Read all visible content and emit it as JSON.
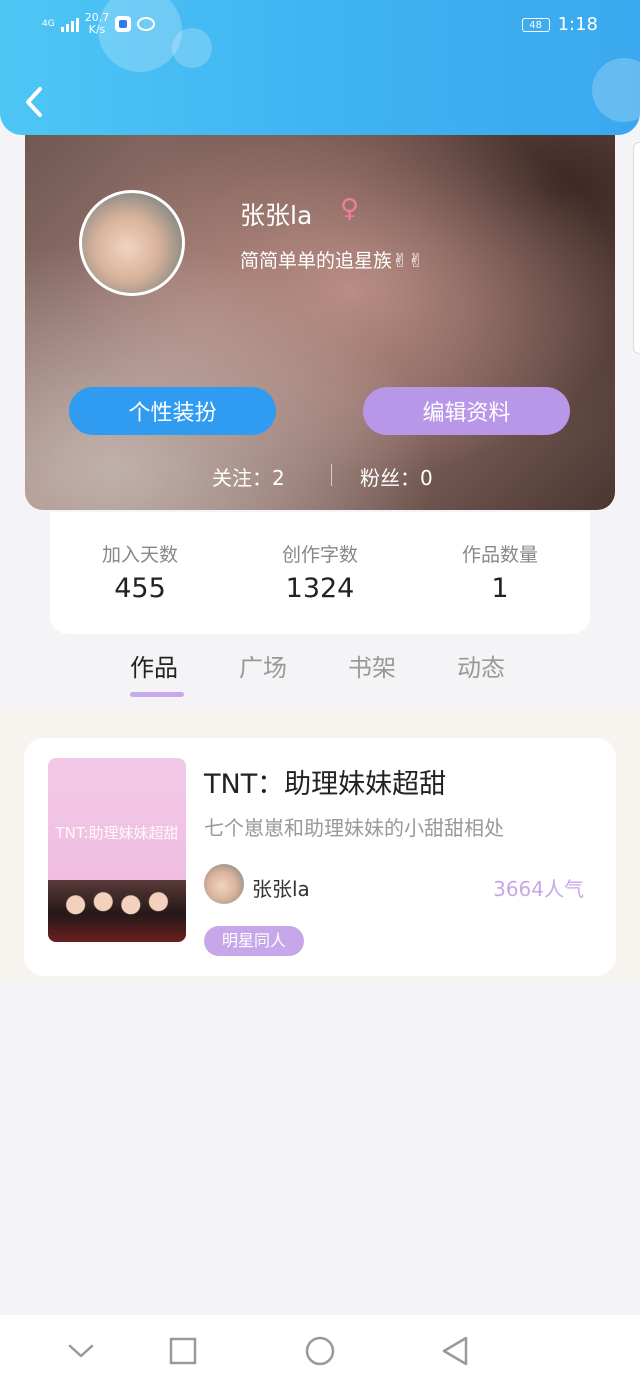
{
  "status_bar": {
    "network": "4G",
    "speed_value": "20.7",
    "speed_unit": "K/s",
    "battery": "48",
    "time": "1:18"
  },
  "profile": {
    "username": "张张la",
    "gender_symbol": "♀",
    "bio": "简简单单的追星族✌✌",
    "dress_button": "个性装扮",
    "edit_button": "编辑资料",
    "following": "关注：2",
    "fans": "粉丝：0"
  },
  "stats": [
    {
      "label": "加入天数",
      "value": "455"
    },
    {
      "label": "创作字数",
      "value": "1324"
    },
    {
      "label": "作品数量",
      "value": "1"
    }
  ],
  "tabs": [
    {
      "label": "作品",
      "active": true
    },
    {
      "label": "广场",
      "active": false
    },
    {
      "label": "书架",
      "active": false
    },
    {
      "label": "动态",
      "active": false
    }
  ],
  "work": {
    "cover_text": "TNT:助理妹妹超甜",
    "title": "TNT：助理妹妹超甜",
    "description": "七个崽崽和助理妹妹的小甜甜相处",
    "author": "张张la",
    "popularity": "3664人气",
    "tag": "明星同人"
  },
  "colors": {
    "header": "#3fb2f1",
    "accent_blue": "#2f9cf2",
    "accent_purple": "#b896e8"
  },
  "icons": {
    "back": "chevron-left-icon",
    "nav": [
      "chevron-down-icon",
      "square-recent-icon",
      "circle-home-icon",
      "triangle-back-icon"
    ]
  }
}
